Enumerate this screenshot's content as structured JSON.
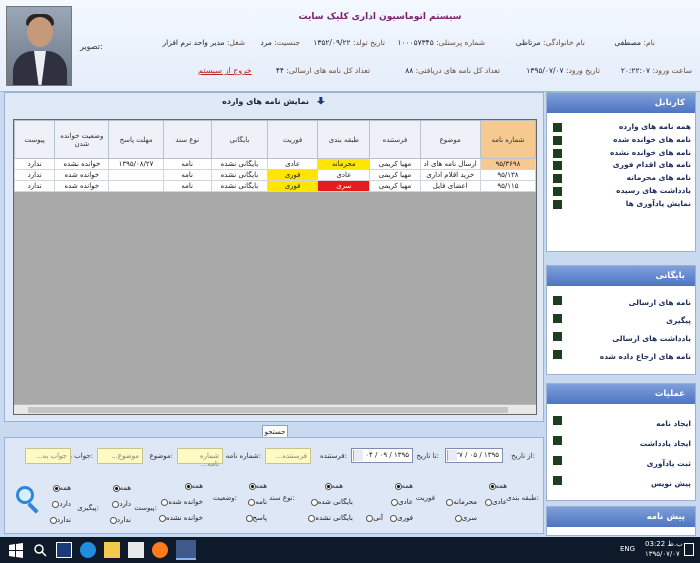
{
  "header": {
    "system_title": "سیستم اتوماسیون اداری کلیک سایت",
    "photo_label": "تصویر:",
    "name_label": "نام:",
    "name_value": "مصطفی",
    "family_label": "نام خانوادگی:",
    "family_value": "مرتاظی",
    "personnel_label": "شماره پرسنلی:",
    "personnel_value": "۱۰۰۰۵۷۳۴۵",
    "birth_label": "تاریخ تولد:",
    "birth_value": "۱۳۵۲/۰۹/۲۲",
    "gender_label": "جنسیت:",
    "gender_value": "مرد",
    "job_label": "شغل:",
    "job_value": "مدیر واحد نرم افزار",
    "login_time_label": "ساعت ورود:",
    "login_time_value": "۲۰:۲۲:۰۷",
    "login_date_label": "تاریخ ورود:",
    "login_date_value": "۱۳۹۵/۰۷/۰۷",
    "received_label": "تعداد کل نامه های دریافتی:",
    "received_value": "۸۸",
    "sent_label": "تعداد کل نامه های ارسالی:",
    "sent_value": "۴۴",
    "exit_label": "خروج از سیستم"
  },
  "main": {
    "title": "نمایش نامه های وارده",
    "columns": [
      "شماره نامه",
      "موضوع",
      "فرستنده",
      "طبقه بندی",
      "فوریت",
      "بایگانی",
      "نوع سند",
      "مهلت پاسخ",
      "وضعیت خوانده شدن",
      "پیوست"
    ],
    "rows": [
      [
        "۹۵/۳۶۹۸",
        "ارسال نامه های اد",
        "مهیا کریمی",
        "محرمانه",
        "عادی",
        "بایگانی نشده",
        "نامه",
        "۱۳۹۵/۰۸/۲۷",
        "خوانده نشده",
        "ندارد"
      ],
      [
        "۹۵/۱۳۸",
        "خرید اقلام اداری",
        "مهیا کریمی",
        "عادی",
        "فوری",
        "بایگانی نشده",
        "نامه",
        "",
        "خوانده شده",
        "ندارد"
      ],
      [
        "۹۵/۱۱۵",
        "اعضای فایل",
        "مهیا کریمی",
        "سری",
        "فوری",
        "بایگانی نشده",
        "نامه",
        "",
        "خوانده شده",
        "ندارد"
      ]
    ]
  },
  "search": {
    "tab_label": "جستجو",
    "from_date_label": "از تاریخ:",
    "from_date_value": "۱۳۹۵ / ۰۵ / ۲۷",
    "to_date_label": "تا تاریخ:",
    "to_date_value": "۱۳۹۵ / ۰۹ / ۰۴",
    "sender_label": "فرستنده:",
    "sender_placeholder": "فرستنده...",
    "letter_no_label": "شماره نامه:",
    "letter_no_placeholder": "شماره نامه...",
    "subject_label": "موضوع:",
    "subject_placeholder": "موضوع...",
    "reply_label": "جواب به:",
    "reply_placeholder": "جواب به...",
    "classification_label": "طبقه بندی:",
    "classification_options": [
      "همه",
      "عادی",
      "محرمانه",
      "سری"
    ],
    "urgency_label": "فوریت",
    "urgency_options": [
      "همه",
      "عادی",
      "فوری",
      "آنی"
    ],
    "archive_label": "",
    "archive_options": [
      "همه",
      "بایگانی شده",
      "بایگانی نشده"
    ],
    "doctype_label": "نوع سند:",
    "doctype_options": [
      "همه",
      "نامه",
      "پاسخ"
    ],
    "status_label": "وضعیت:",
    "status_options": [
      "همه",
      "خوانده شده",
      "خوانده نشده"
    ],
    "attachment_label": "پیوست:",
    "attachment_options": [
      "همه",
      "دارد",
      "ندارد"
    ],
    "followup_label": "پیگیری:",
    "followup_options": [
      "همه",
      "دارد",
      "ندارد"
    ]
  },
  "sidebar": {
    "cartable_title": "کارتابل",
    "cartable_items": [
      "همه نامه های وارده",
      "نامه های خوانده شده",
      "نامه های خوانده نشده",
      "نامه های اقدام فوری",
      "نامه های محرمانه",
      "یادداشت های رسیده",
      "نمایش یادآوری ها"
    ],
    "archive_title": "بایگانی",
    "archive_items": [
      "نامه های ارسالی",
      "پیگیری",
      "یادداشت های ارسالی",
      "نامه های ارجاع داده شده"
    ],
    "ops_title": "عملیات",
    "ops_items": [
      "ایجاد نامه",
      "ایجاد یادداشت",
      "ثبت یادآوری",
      "پیش نویس"
    ],
    "draft_title": "پیش نامه"
  },
  "taskbar": {
    "lang": "ENG",
    "time": "03:22 ب.ظ",
    "date": "۱۳۹۵/۰۷/۰۷"
  }
}
